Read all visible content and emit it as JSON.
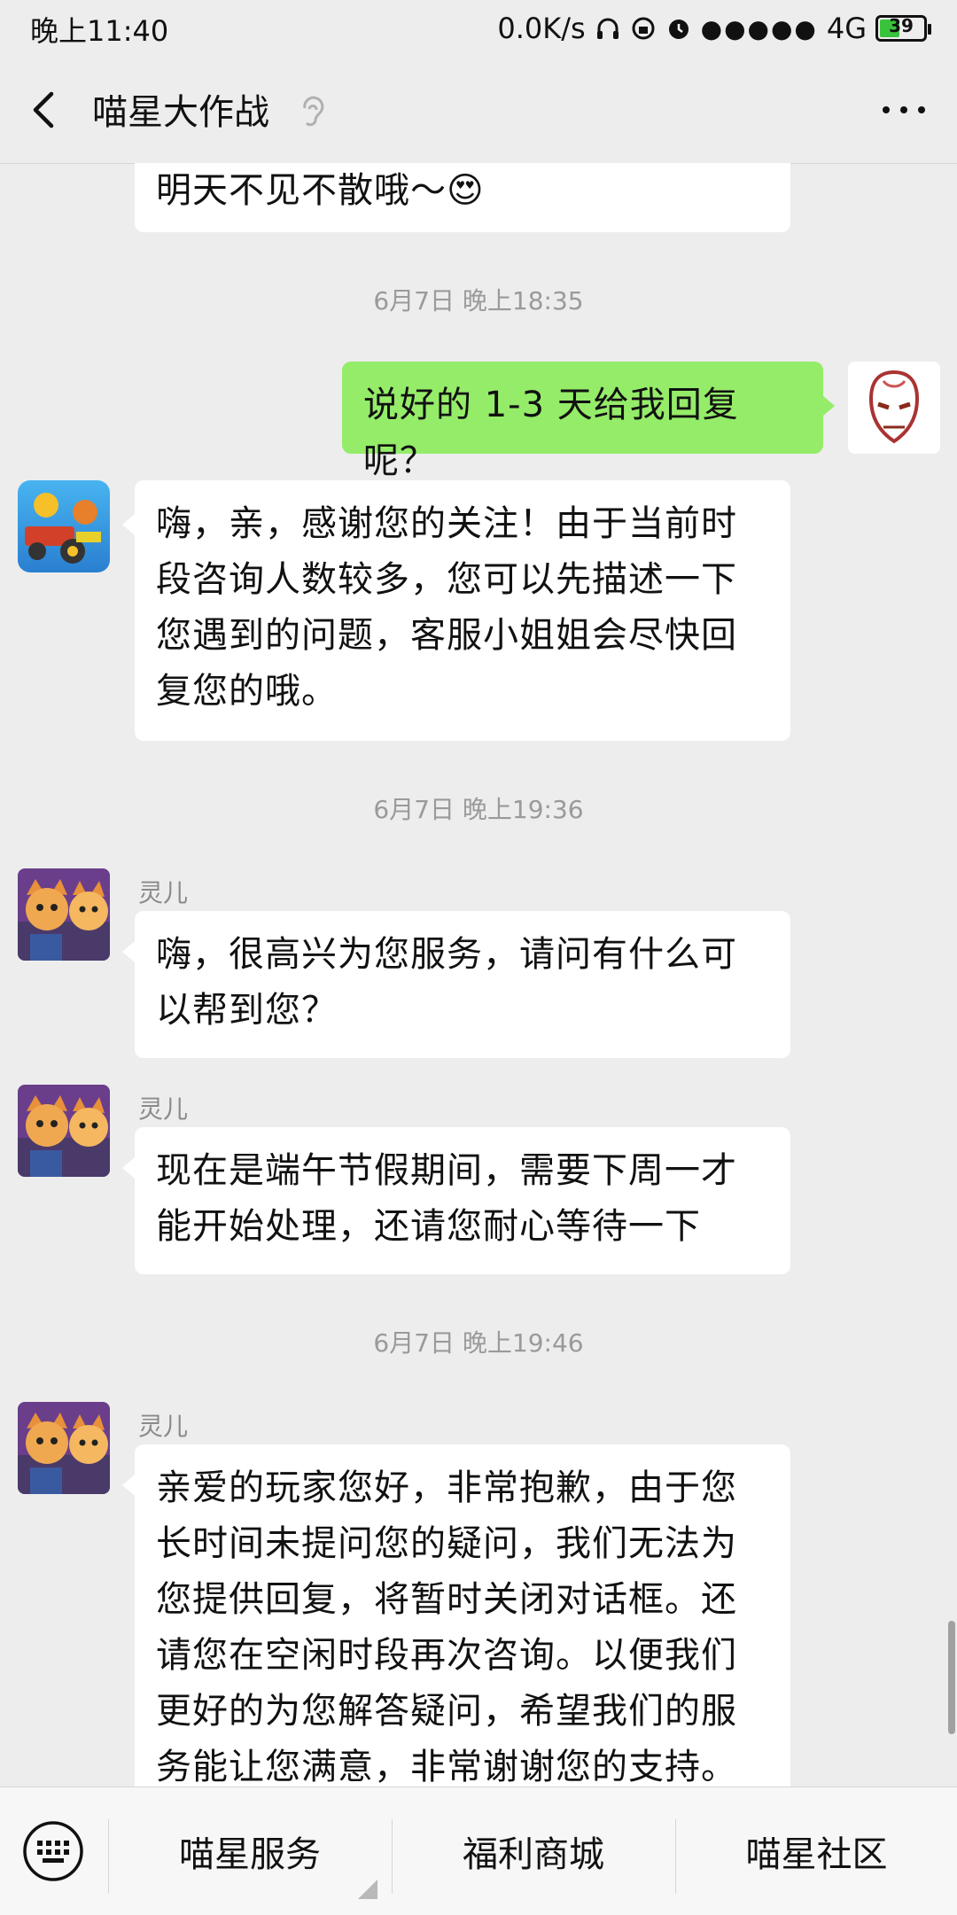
{
  "status_bar": {
    "time": "晚上11:40",
    "net_speed": "0.0K/s",
    "signal_dots": "●●●●●",
    "network": "4G",
    "battery": "39"
  },
  "nav": {
    "title": "喵星大作战"
  },
  "messages": [
    {
      "type": "received",
      "text": "明天不见不散哦～😍"
    },
    {
      "type": "time",
      "text": "6月7日 晚上18:35"
    },
    {
      "type": "sent",
      "text": "说好的 1-3 天给我回复呢？"
    },
    {
      "type": "received",
      "text": "嗨，亲，感谢您的关注！由于当前时段咨询人数较多，您可以先描述一下您遇到的问题，客服小姐姐会尽快回复您的哦。"
    },
    {
      "type": "time",
      "text": "6月7日 晚上19:36"
    },
    {
      "type": "received",
      "sender": "灵儿",
      "text": "嗨，很高兴为您服务，请问有什么可以帮到您？"
    },
    {
      "type": "received",
      "sender": "灵儿",
      "text": "现在是端午节假期间，需要下周一才能开始处理，还请您耐心等待一下"
    },
    {
      "type": "time",
      "text": "6月7日 晚上19:46"
    },
    {
      "type": "received",
      "sender": "灵儿",
      "text": "亲爱的玩家您好，非常抱歉，由于您长时间未提问您的疑问，我们无法为您提供回复，将暂时关闭对话框。还请您在空闲时段再次咨询。以便我们更好的为您解答疑问，希望我们的服务能让您满意，非常谢谢您的支持。"
    }
  ],
  "bottom_menu": {
    "items": [
      "喵星服务",
      "福利商城",
      "喵星社区"
    ]
  },
  "colors": {
    "sent_bubble": "#95ec69",
    "received_bubble": "#ffffff",
    "background": "#ededed"
  }
}
